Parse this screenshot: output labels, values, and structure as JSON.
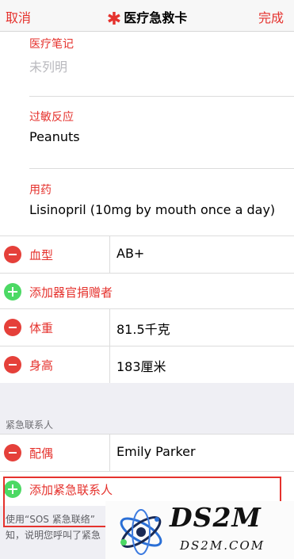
{
  "nav": {
    "cancel": "取消",
    "title": "医疗急救卡",
    "done": "完成",
    "star": "✱"
  },
  "notes": {
    "label": "医疗笔记",
    "value": "未列明"
  },
  "allergies": {
    "label": "过敏反应",
    "value": "Peanuts"
  },
  "medications": {
    "label": "用药",
    "value": "Lisinopril (10mg by mouth once a day)"
  },
  "rows": [
    {
      "label": "血型",
      "value": "AB+"
    },
    {
      "label": "添加器官捐赠者"
    },
    {
      "label": "体重",
      "value": "81.5千克"
    },
    {
      "label": "身高",
      "value": "183厘米"
    }
  ],
  "emergency": {
    "section_header": "紧急联系人",
    "contact": {
      "label": "配偶",
      "value": "Emily Parker"
    },
    "add_label": "添加紧急联系人",
    "footer_line1": "使用“SOS 紧急联络”",
    "footer_line2": "知，说明您呼叫了紧急"
  },
  "watermark": {
    "logo": "DS2M",
    "sub": "DS2M.COM"
  },
  "colors": {
    "accent": "#e5322d",
    "add_green": "#4cd964",
    "remove_red": "#e5403a",
    "group_bg": "#efeff4"
  }
}
